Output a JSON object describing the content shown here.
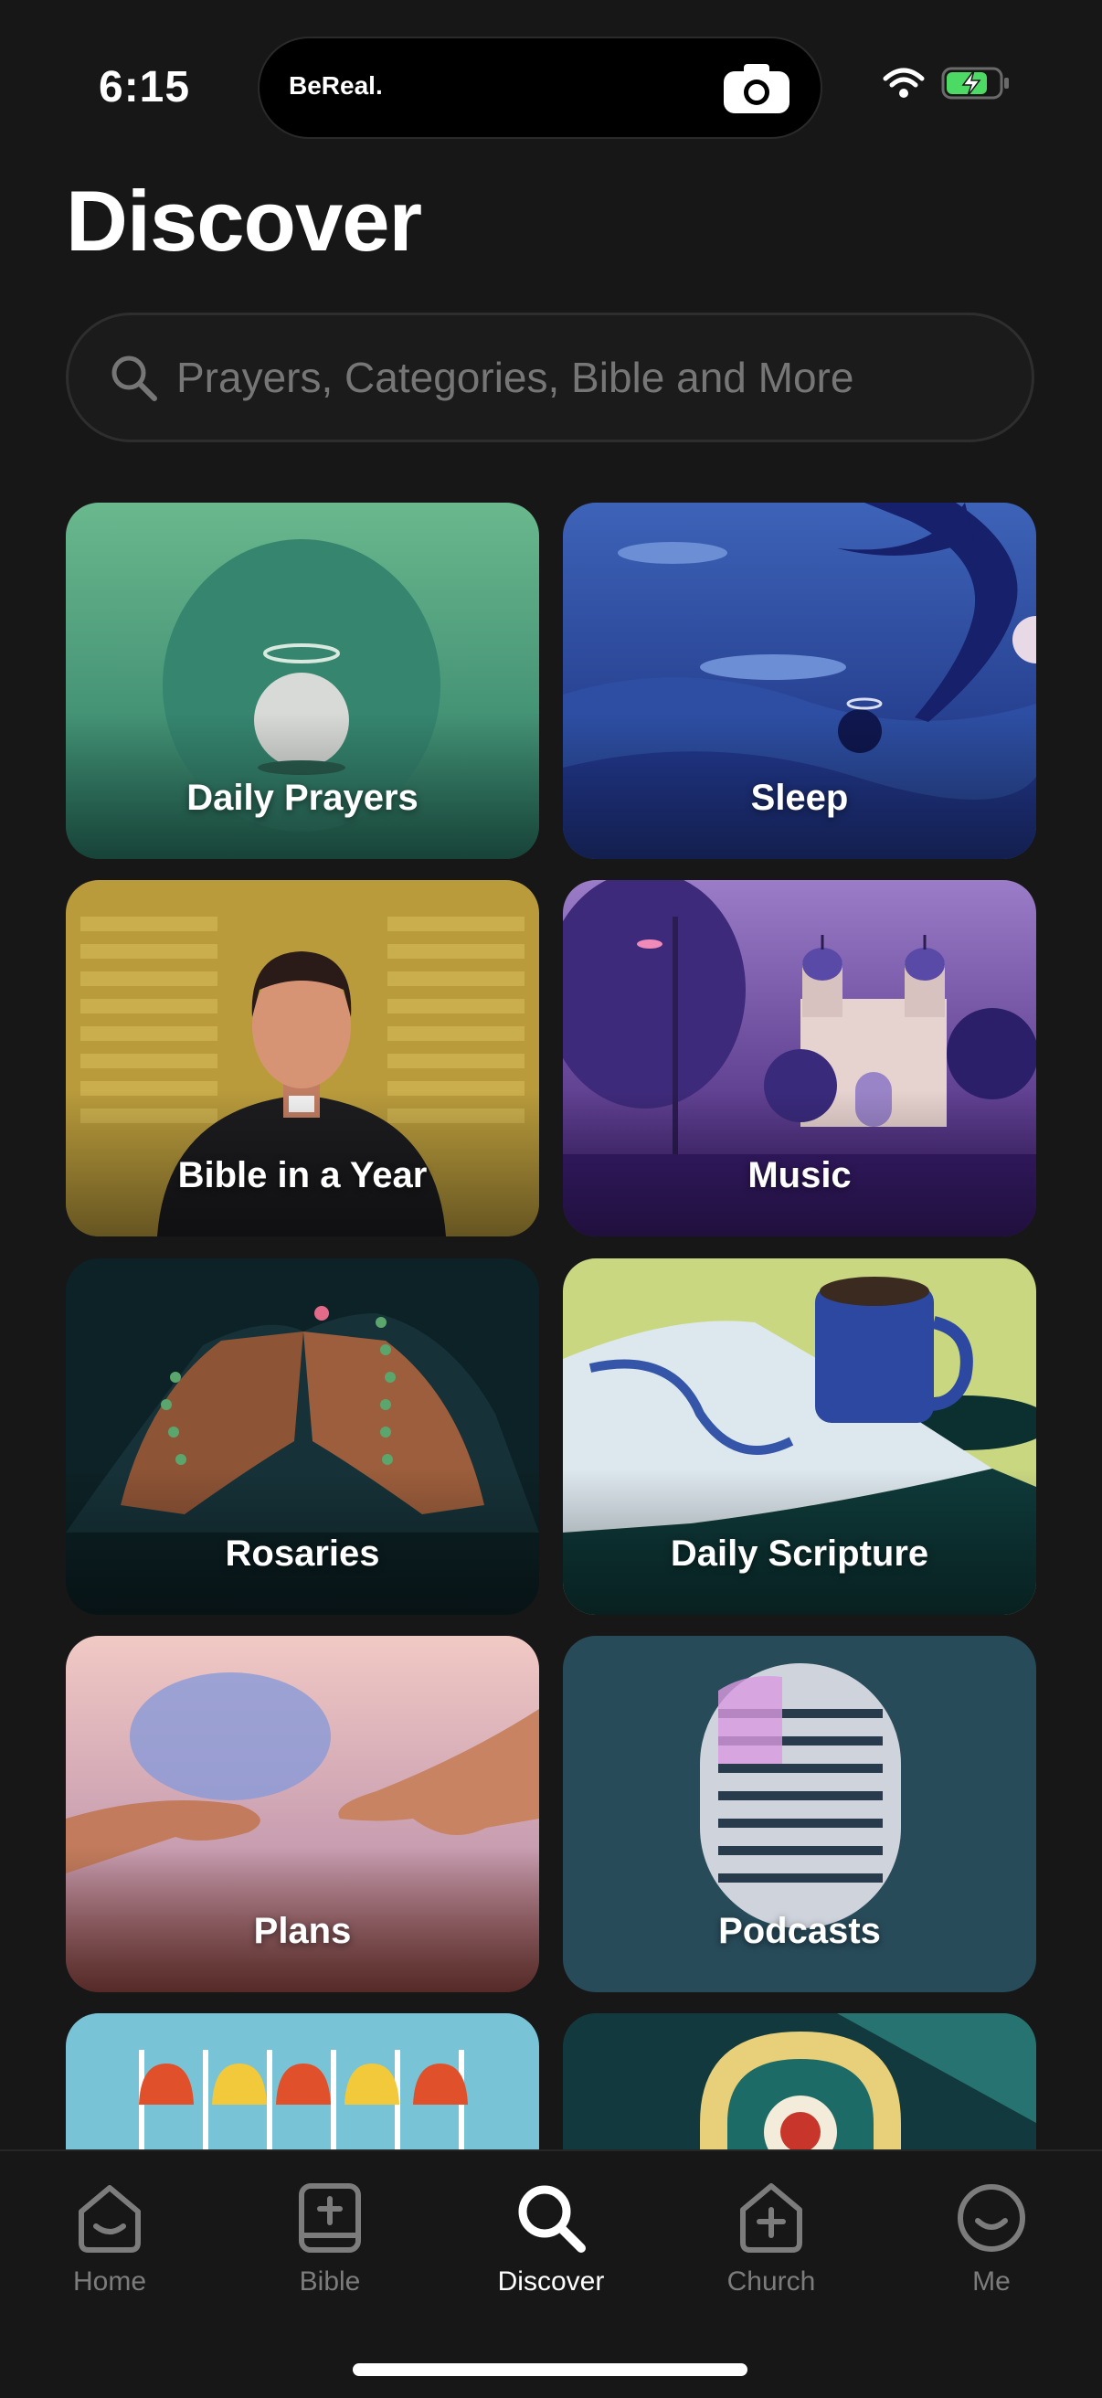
{
  "status": {
    "time": "6:15",
    "island_label": "BeReal."
  },
  "page": {
    "title": "Discover"
  },
  "search": {
    "placeholder": "Prayers, Categories, Bible and More"
  },
  "cards": [
    {
      "label": "Daily Prayers"
    },
    {
      "label": "Sleep"
    },
    {
      "label": "Bible in a Year"
    },
    {
      "label": "Music"
    },
    {
      "label": "Rosaries"
    },
    {
      "label": "Daily Scripture"
    },
    {
      "label": "Plans"
    },
    {
      "label": "Podcasts"
    }
  ],
  "tabs": [
    {
      "label": "Home",
      "icon": "home-icon"
    },
    {
      "label": "Bible",
      "icon": "bible-icon"
    },
    {
      "label": "Discover",
      "icon": "search-icon",
      "active": true
    },
    {
      "label": "Church",
      "icon": "church-icon"
    },
    {
      "label": "Me",
      "icon": "profile-icon"
    }
  ],
  "colors": {
    "background": "#171717",
    "active_tab": "#ffffff",
    "inactive_tab": "#7c7c7c"
  }
}
